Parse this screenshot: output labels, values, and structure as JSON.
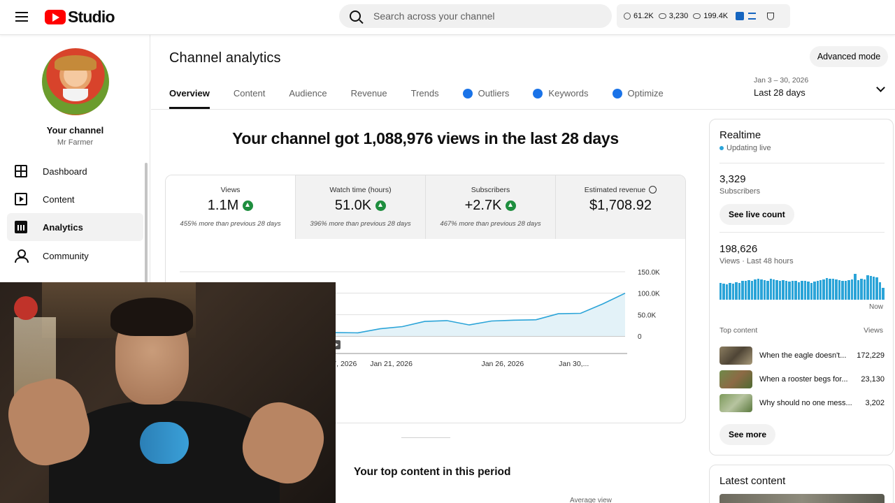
{
  "app": {
    "logo_text": "Studio",
    "search_placeholder": "Search across your channel",
    "stats": {
      "a": "61.2K",
      "b": "3,230",
      "c": "199.4K"
    }
  },
  "sidebar": {
    "channel_title": "Your channel",
    "channel_name": "Mr Farmer",
    "items": [
      {
        "label": "Dashboard",
        "icon": "dashboard-icon"
      },
      {
        "label": "Content",
        "icon": "content-icon"
      },
      {
        "label": "Analytics",
        "icon": "analytics-icon",
        "active": true
      },
      {
        "label": "Community",
        "icon": "community-icon"
      }
    ]
  },
  "header": {
    "title": "Channel analytics",
    "advanced_mode": "Advanced mode",
    "tabs": [
      "Overview",
      "Content",
      "Audience",
      "Revenue",
      "Trends",
      "Outliers",
      "Keywords",
      "Optimize"
    ],
    "date_small": "Jan 3 – 30, 2026",
    "date_big": "Last 28 days"
  },
  "overview": {
    "headline": "Your channel got 1,088,976 views in the last 28 days",
    "metrics": [
      {
        "label": "Views",
        "value": "1.1M",
        "note": "455% more than previous 28 days",
        "trend": "up"
      },
      {
        "label": "Watch time (hours)",
        "value": "51.0K",
        "note": "396% more than previous 28 days",
        "trend": "up"
      },
      {
        "label": "Subscribers",
        "value": "+2.7K",
        "note": "467% more than previous 28 days",
        "trend": "up"
      },
      {
        "label": "Estimated revenue",
        "value": "$1,708.92",
        "note": "",
        "trend": "none"
      }
    ],
    "top_content_title": "Your top content in this period",
    "avg_view_label": "Average view"
  },
  "chart_data": {
    "type": "area",
    "color": "#2ba4d8",
    "y_ticks": [
      "150.0K",
      "100.0K",
      "50.0K",
      "0"
    ],
    "ylim": [
      0,
      150000
    ],
    "x_ticks": [
      "2026",
      "Jan 17, 2026",
      "Jan 21, 2026",
      "Jan 26, 2026",
      "Jan 30,..."
    ],
    "x": [
      13,
      14,
      15,
      16,
      17,
      18,
      19,
      20,
      21,
      22,
      23,
      24,
      25,
      26,
      27,
      28,
      29,
      30
    ],
    "values": [
      7000,
      8000,
      9000,
      8000,
      8000,
      7500,
      17000,
      22000,
      34000,
      36000,
      26000,
      35000,
      37000,
      38000,
      52000,
      53000,
      75000,
      100000
    ]
  },
  "realtime": {
    "title": "Realtime",
    "live": "Updating live",
    "subs_value": "3,329",
    "subs_label": "Subscribers",
    "live_count_button": "See live count",
    "views_value": "198,626",
    "views_label": "Views · Last 48 hours",
    "now_label": "Now",
    "bars": [
      0.62,
      0.6,
      0.58,
      0.62,
      0.6,
      0.66,
      0.64,
      0.7,
      0.72,
      0.74,
      0.72,
      0.76,
      0.78,
      0.76,
      0.74,
      0.72,
      0.78,
      0.76,
      0.74,
      0.7,
      0.74,
      0.72,
      0.68,
      0.72,
      0.7,
      0.66,
      0.7,
      0.72,
      0.68,
      0.64,
      0.68,
      0.72,
      0.74,
      0.76,
      0.82,
      0.8,
      0.78,
      0.76,
      0.74,
      0.7,
      0.72,
      0.74,
      0.76,
      0.98,
      0.74,
      0.8,
      0.76,
      0.92,
      0.9,
      0.88,
      0.84,
      0.66,
      0.46
    ],
    "top_content_label": "Top content",
    "views_col_label": "Views",
    "top_content": [
      {
        "title": "When the eagle doesn't...",
        "views": "172,229"
      },
      {
        "title": "When a rooster begs for...",
        "views": "23,130"
      },
      {
        "title": "Why should no one mess...",
        "views": "3,202"
      }
    ],
    "see_more": "See more"
  },
  "latest": {
    "title": "Latest content"
  }
}
